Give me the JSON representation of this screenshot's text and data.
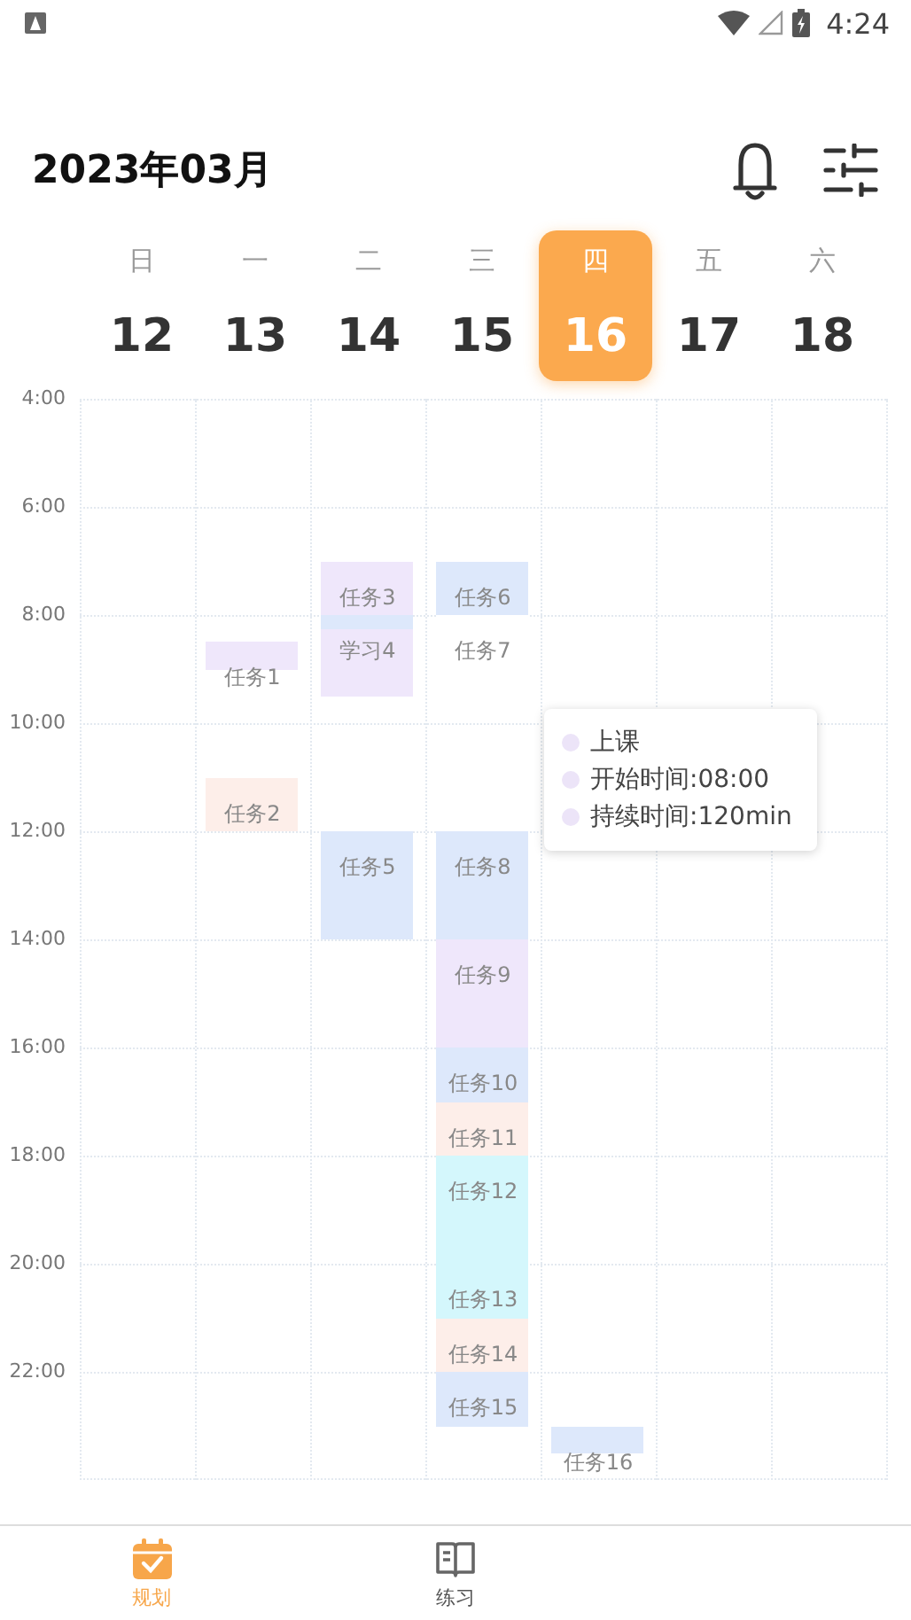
{
  "status_bar": {
    "time": "4:24"
  },
  "header": {
    "title": "2023年03月"
  },
  "week": [
    {
      "weekday": "日",
      "date": "12",
      "selected": false
    },
    {
      "weekday": "一",
      "date": "13",
      "selected": false
    },
    {
      "weekday": "二",
      "date": "14",
      "selected": false
    },
    {
      "weekday": "三",
      "date": "15",
      "selected": false
    },
    {
      "weekday": "四",
      "date": "16",
      "selected": true
    },
    {
      "weekday": "五",
      "date": "17",
      "selected": false
    },
    {
      "weekday": "六",
      "date": "18",
      "selected": false
    }
  ],
  "hours": [
    "4:00",
    "6:00",
    "8:00",
    "10:00",
    "12:00",
    "14:00",
    "16:00",
    "18:00",
    "20:00",
    "22:00"
  ],
  "events": [
    {
      "color": "#efe7fb",
      "title": "任务1"
    },
    {
      "color": "#fdeee9",
      "title": "任务2"
    },
    {
      "color": "#efe7fb",
      "title": "任务3"
    },
    {
      "color": "#efe7fb",
      "title": "学习4"
    },
    {
      "color": "#dde8fb"
    },
    {
      "color": "#dde8fb",
      "title": "任务5"
    },
    {
      "color": "#dde8fb",
      "title": "任务6"
    },
    {
      "color": "#ffffff",
      "title": "任务7"
    },
    {
      "color": "#dde8fb",
      "title": "任务8"
    },
    {
      "color": "#efe7fb",
      "title": "任务9"
    },
    {
      "color": "#dde8fb",
      "title": "任务10"
    },
    {
      "color": "#fdeee9",
      "title": "任务11"
    },
    {
      "color": "#d4f7fc",
      "title": "任务12"
    },
    {
      "color": "#d4f7fc",
      "title": "任务13"
    },
    {
      "color": "#fdeee9",
      "title": "任务14"
    },
    {
      "color": "#dde8fb",
      "title": "任务15"
    },
    {
      "color": "#dde8fb",
      "title": "任务16"
    }
  ],
  "tooltip": {
    "lines": [
      "上课",
      "开始时间:08:00",
      "持续时间:120min"
    ]
  },
  "tabs": [
    {
      "label": "规划",
      "selected": true
    },
    {
      "label": "练习",
      "selected": false
    }
  ]
}
